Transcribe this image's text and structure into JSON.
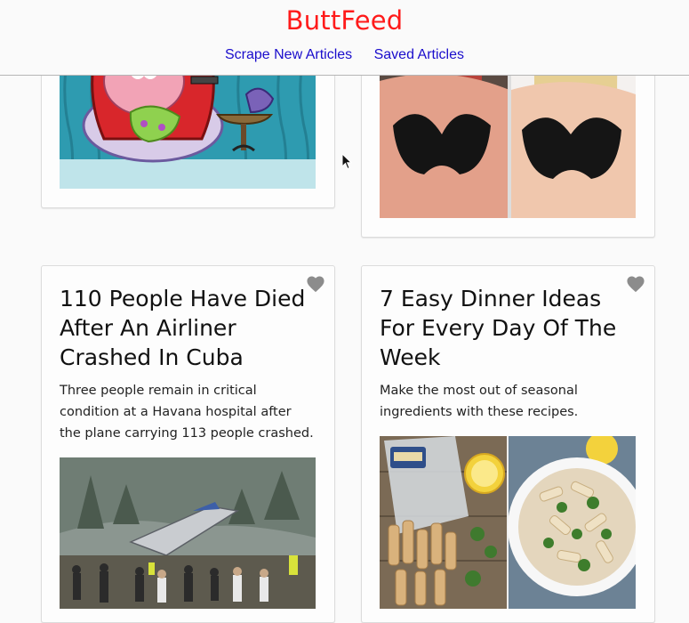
{
  "header": {
    "brand": "ButtFeed",
    "nav": {
      "scrape": "Scrape New Articles",
      "saved": "Saved Articles"
    }
  },
  "articles": [
    {
      "title": "",
      "description": "",
      "image": "cartoon-starfish-armchair-image"
    },
    {
      "title": "",
      "description": "",
      "image": "side-by-side-bra-photos-image"
    },
    {
      "title": "110 People Have Died After An Airliner Crashed In Cuba",
      "description": "Three people remain in critical condition at a Havana hospital after the plane carrying 113 people crashed.",
      "image": "plane-crash-wreckage-image",
      "saved": false
    },
    {
      "title": "7 Easy Dinner Ideas For Every Day Of The Week",
      "description": "Make the most out of seasonal ingredients with these recipes.",
      "image": "pasta-salad-bowl-image",
      "saved": false
    }
  ],
  "colors": {
    "brand": "#ff1a1a",
    "link": "#1a0dcc",
    "heart": "#8c8c8c"
  },
  "icons": {
    "save": "heart-icon",
    "pointer": "mouse-cursor-icon"
  }
}
